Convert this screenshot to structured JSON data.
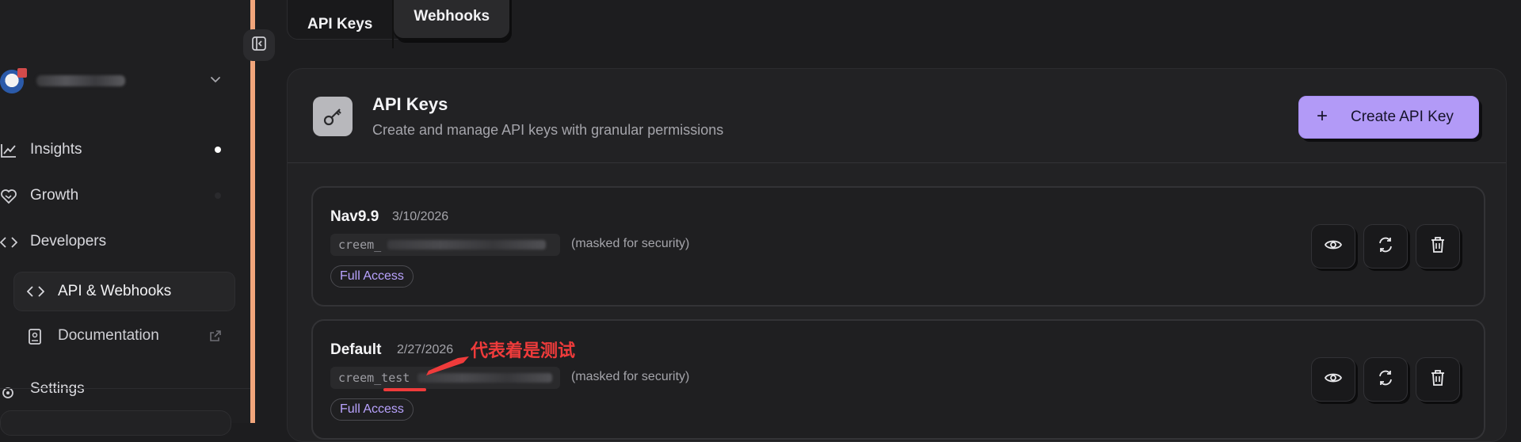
{
  "sidebar": {
    "account_chevron_icon": "chevron-down-icon",
    "items": [
      {
        "label": "Insights",
        "icon": "line-chart-icon"
      },
      {
        "label": "Growth",
        "icon": "heart-handshake-icon"
      },
      {
        "label": "Developers",
        "icon": "code-icon"
      }
    ],
    "sub_items": [
      {
        "label": "API & Webhooks",
        "icon": "code-icon"
      },
      {
        "label": "Documentation",
        "icon": "book-icon"
      }
    ],
    "settings_label": "Settings"
  },
  "tabs": [
    {
      "label": "API Keys"
    },
    {
      "label": "Webhooks"
    }
  ],
  "panel": {
    "title": "API Keys",
    "subtitle": "Create and manage API keys with granular permissions",
    "create_button": "Create API Key"
  },
  "keys": [
    {
      "name": "Nav9.9",
      "date": "3/10/2026",
      "prefix": "creem_",
      "masked_note": "(masked for security)",
      "access": "Full Access"
    },
    {
      "name": "Default",
      "date": "2/27/2026",
      "prefix": "creem_test",
      "masked_note": "(masked for security)",
      "access": "Full Access"
    }
  ],
  "annotation": {
    "text": "代表着是测试",
    "color": "#ef3b3b"
  },
  "colors": {
    "accent": "#b29af7",
    "sidebar_border": "#f1a57b",
    "badge_text": "#b9a3ff"
  }
}
